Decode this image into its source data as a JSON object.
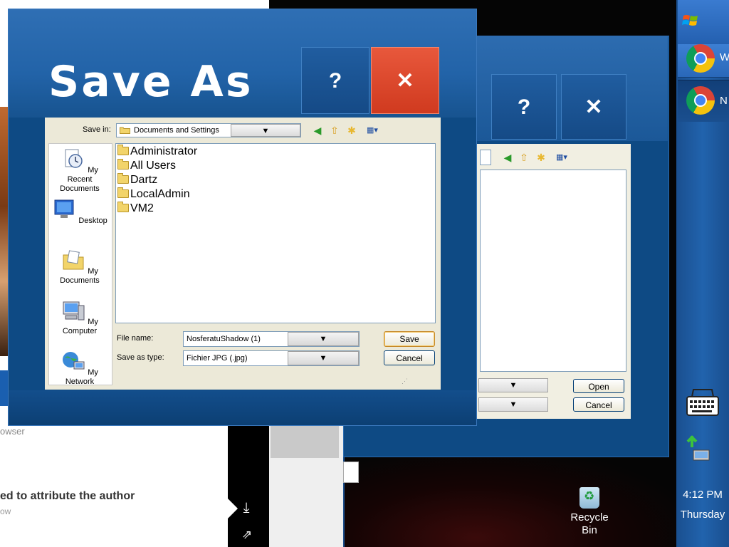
{
  "browser_page": {
    "fade_text": "owser",
    "headline": "ed to attribute the author",
    "sub_text": "ow"
  },
  "desktop": {
    "recycle_bin_label": "Recycle Bin",
    "recycle_bin_icon": "recycle-bin-icon"
  },
  "taskbar": {
    "start_icon": "windows-flag-icon",
    "items": [
      {
        "label": "W",
        "icon": "chrome-icon"
      },
      {
        "label": "N",
        "icon": "chrome-icon"
      }
    ],
    "tray_icons": [
      "keyboard-icon",
      "network-icon"
    ],
    "clock": {
      "time": "4:12 PM",
      "day": "Thursday"
    }
  },
  "open_dialog": {
    "help_label": "?",
    "close_label": "✕",
    "open_label": "Open",
    "cancel_label": "Cancel",
    "dropdown_arrow": "▼"
  },
  "save_dialog": {
    "title": "Save As",
    "help_label": "?",
    "close_label": "✕",
    "save_in_label": "Save in:",
    "save_in_value": "Documents and Settings",
    "dropdown_arrow": "▼",
    "toolbar_icons": [
      "back-icon",
      "up-folder-icon",
      "new-folder-icon",
      "view-menu-icon"
    ],
    "places": [
      {
        "label": "My Recent Documents",
        "icon": "recent-documents-icon"
      },
      {
        "label": "Desktop",
        "icon": "desktop-icon"
      },
      {
        "label": "My Documents",
        "icon": "my-documents-icon"
      },
      {
        "label": "My Computer",
        "icon": "my-computer-icon"
      },
      {
        "label": "My Network",
        "icon": "my-network-icon"
      }
    ],
    "folders": [
      "Administrator",
      "All Users",
      "Dartz",
      "LocalAdmin",
      "VM2"
    ],
    "file_name_label": "File name:",
    "file_name_value": "NosferatuShadow (1)",
    "save_as_type_label": "Save as type:",
    "save_as_type_value": "Fichier JPG (.jpg)",
    "save_label": "Save",
    "cancel_label": "Cancel"
  }
}
